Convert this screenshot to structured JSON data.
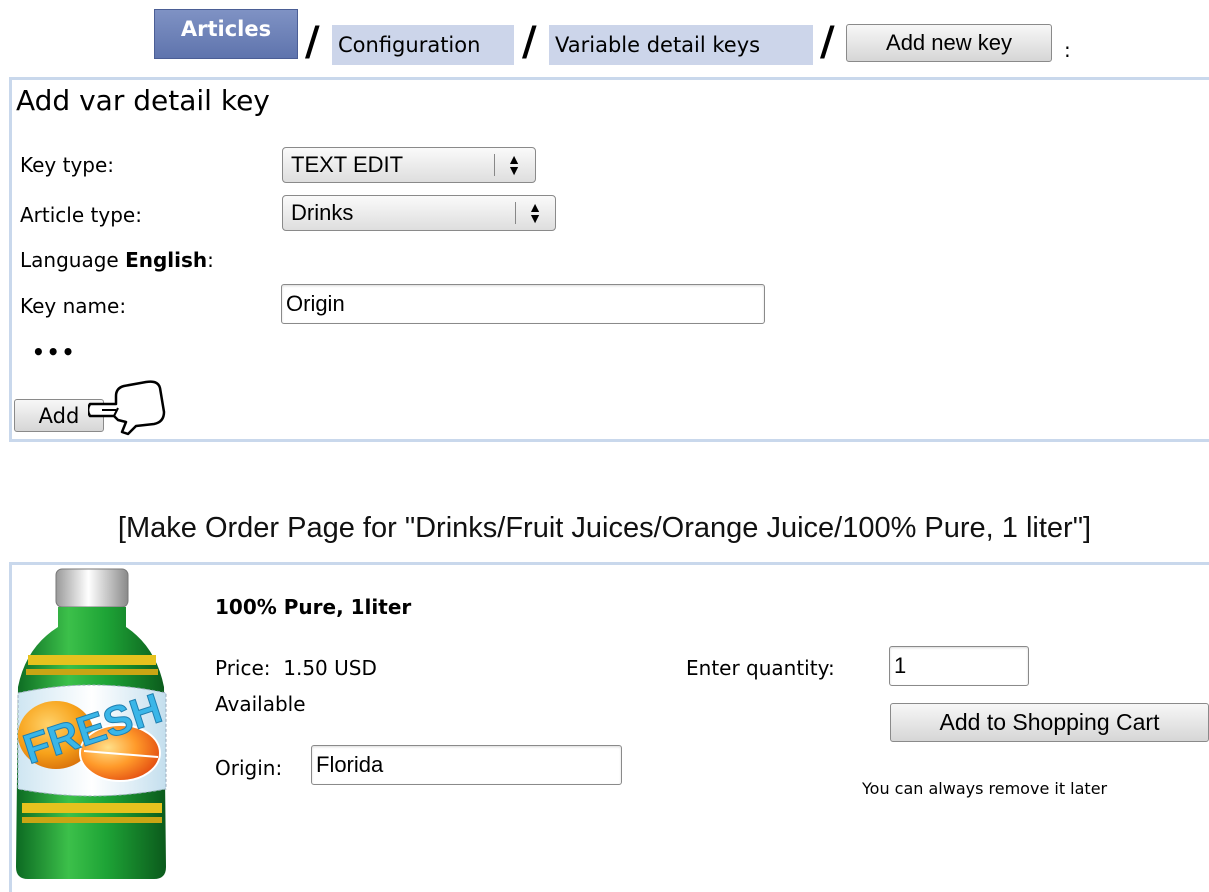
{
  "breadcrumb": {
    "articles": "Articles",
    "separator": "/",
    "configuration": "Configuration",
    "variable_detail_keys": "Variable detail keys",
    "add_new_key": "Add new key",
    "trailing": ":"
  },
  "form": {
    "title": "Add var detail key",
    "key_type_label": "Key type:",
    "key_type_value": "TEXT EDIT",
    "article_type_label": "Article type:",
    "article_type_value": "Drinks",
    "language_prefix": "Language ",
    "language_name": "English",
    "language_suffix": ":",
    "key_name_label": "Key name:",
    "key_name_value": "Origin",
    "ellipsis": "•••",
    "add_button": "Add"
  },
  "caption": "[Make Order Page for \"Drinks/Fruit Juices/Orange Juice/100% Pure, 1 liter\"]",
  "product": {
    "bottle_text": "FRESH",
    "name": "100% Pure, 1liter",
    "price_label": "Price:",
    "price_value": "1.50 USD",
    "availability": "Available",
    "origin_label": "Origin:",
    "origin_value": "Florida",
    "quantity_label": "Enter quantity:",
    "quantity_value": "1",
    "add_to_cart": "Add to Shopping Cart",
    "remove_note": "You can always remove it later"
  },
  "colors": {
    "articles_tab": "#6b7fb8",
    "crumb_bg": "#ccd5ea",
    "panel_border": "#c9d8ec"
  }
}
